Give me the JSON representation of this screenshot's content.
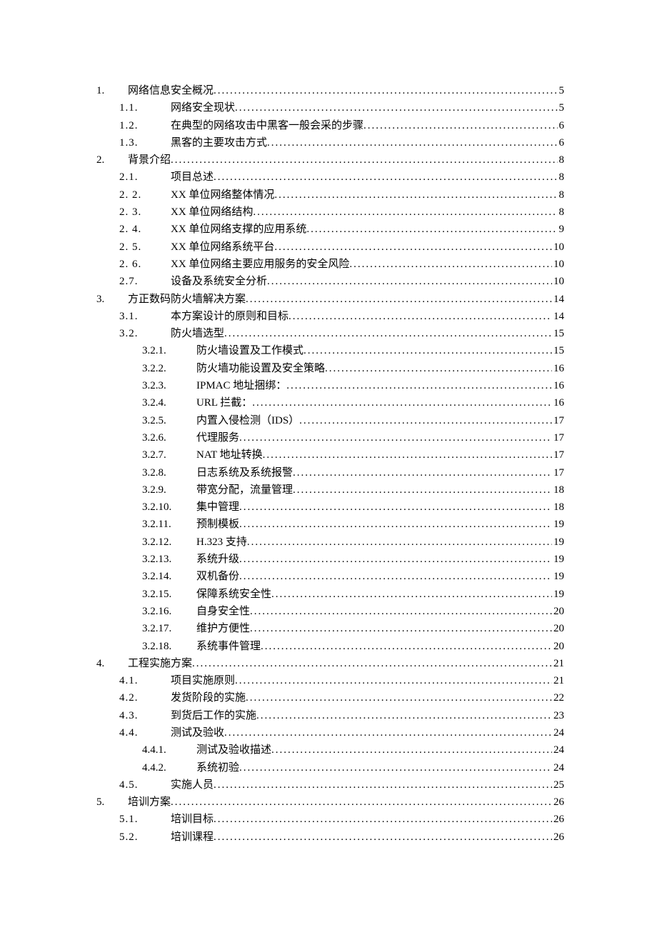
{
  "toc": [
    {
      "level": 0,
      "num": "1.",
      "title": "网络信息安全概况",
      "page": "5"
    },
    {
      "level": 1,
      "num": "1.1.",
      "title": "网络安全现状",
      "page": "5"
    },
    {
      "level": 1,
      "num": "1.2.",
      "title": "在典型的网络攻击中黑客一般会采的步骤",
      "page": "6"
    },
    {
      "level": 1,
      "num": "1.3.",
      "title": "黑客的主要攻击方式",
      "page": "6"
    },
    {
      "level": 0,
      "num": "2.",
      "title": "背景介绍",
      "page": "8"
    },
    {
      "level": 1,
      "num": "2.1.",
      "title": "项目总述",
      "page": "8"
    },
    {
      "level": 1,
      "num": "2. 2.",
      "title": "XX 单位网络整体情况",
      "page": "8"
    },
    {
      "level": 1,
      "num": "2. 3.",
      "title": "XX 单位网络结构",
      "page": "8"
    },
    {
      "level": 1,
      "num": "2. 4.",
      "title": "XX 单位网络支撑的应用系统",
      "page": "9"
    },
    {
      "level": 1,
      "num": "2. 5.",
      "title": "XX 单位网络系统平台",
      "page": "10"
    },
    {
      "level": 1,
      "num": "2. 6.",
      "title": "XX 单位网络主要应用服务的安全风险",
      "page": "10"
    },
    {
      "level": 1,
      "num": "2.7.",
      "title": "设备及系统安全分析",
      "page": "10"
    },
    {
      "level": 0,
      "num": "3.",
      "title": "方正数码防火墙解决方案",
      "page": "14"
    },
    {
      "level": 1,
      "num": "3.1.",
      "title": "本方案设计的原则和目标",
      "page": "14"
    },
    {
      "level": 1,
      "num": "3.2.",
      "title": "防火墙选型",
      "page": "15"
    },
    {
      "level": 2,
      "num": "3.2.1.",
      "title": "防火墙设置及工作模式",
      "page": "15"
    },
    {
      "level": 2,
      "num": "3.2.2.",
      "title": "防火墙功能设置及安全策略",
      "page": "16"
    },
    {
      "level": 2,
      "num": "3.2.3.",
      "title": "IPMAC 地址捆绑：",
      "page": "16"
    },
    {
      "level": 2,
      "num": "3.2.4.",
      "title": "URL 拦截：",
      "page": "16"
    },
    {
      "level": 2,
      "num": "3.2.5.",
      "title": "内置入侵检测（IDS）",
      "page": "17"
    },
    {
      "level": 2,
      "num": "3.2.6.",
      "title": "代理服务",
      "page": "17"
    },
    {
      "level": 2,
      "num": "3.2.7.",
      "title": "NAT 地址转换",
      "page": "17"
    },
    {
      "level": 2,
      "num": "3.2.8.",
      "title": "日志系统及系统报警",
      "page": "17"
    },
    {
      "level": 2,
      "num": "3.2.9.",
      "title": "带宽分配，流量管理",
      "page": "18"
    },
    {
      "level": 2,
      "num": "3.2.10.",
      "title": "集中管理",
      "page": "18"
    },
    {
      "level": 2,
      "num": "3.2.11.",
      "title": "预制模板",
      "page": "19"
    },
    {
      "level": 2,
      "num": "3.2.12.",
      "title": "H.323 支持",
      "page": "19"
    },
    {
      "level": 2,
      "num": "3.2.13.",
      "title": "系统升级",
      "page": "19"
    },
    {
      "level": 2,
      "num": "3.2.14.",
      "title": "双机备份",
      "page": "19"
    },
    {
      "level": 2,
      "num": "3.2.15.",
      "title": "保障系统安全性",
      "page": "19"
    },
    {
      "level": 2,
      "num": "3.2.16.",
      "title": "自身安全性",
      "page": "20"
    },
    {
      "level": 2,
      "num": "3.2.17.",
      "title": "维护方便性",
      "page": "20"
    },
    {
      "level": 2,
      "num": "3.2.18.",
      "title": "系统事件管理",
      "page": "20"
    },
    {
      "level": 0,
      "num": "4.",
      "title": "工程实施方案",
      "page": "21"
    },
    {
      "level": 1,
      "num": "4.1.",
      "title": "项目实施原则",
      "page": "21"
    },
    {
      "level": 1,
      "num": "4.2.",
      "title": "发货阶段的实施",
      "page": "22"
    },
    {
      "level": 1,
      "num": "4.3.",
      "title": "到货后工作的实施",
      "page": "23"
    },
    {
      "level": 1,
      "num": "4.4.",
      "title": "测试及验收",
      "page": "24"
    },
    {
      "level": 2,
      "num": "4.4.1.",
      "title": "测试及验收描述",
      "page": "24"
    },
    {
      "level": 2,
      "num": "4.4.2.",
      "title": "系统初验",
      "page": "24"
    },
    {
      "level": 1,
      "num": "4.5.",
      "title": "实施人员",
      "page": "25"
    },
    {
      "level": 0,
      "num": "5.",
      "title": "培训方案",
      "page": "26"
    },
    {
      "level": 1,
      "num": "5.1.",
      "title": "培训目标",
      "page": "26"
    },
    {
      "level": 1,
      "num": "5.2.",
      "title": "培训课程",
      "page": "26"
    }
  ]
}
